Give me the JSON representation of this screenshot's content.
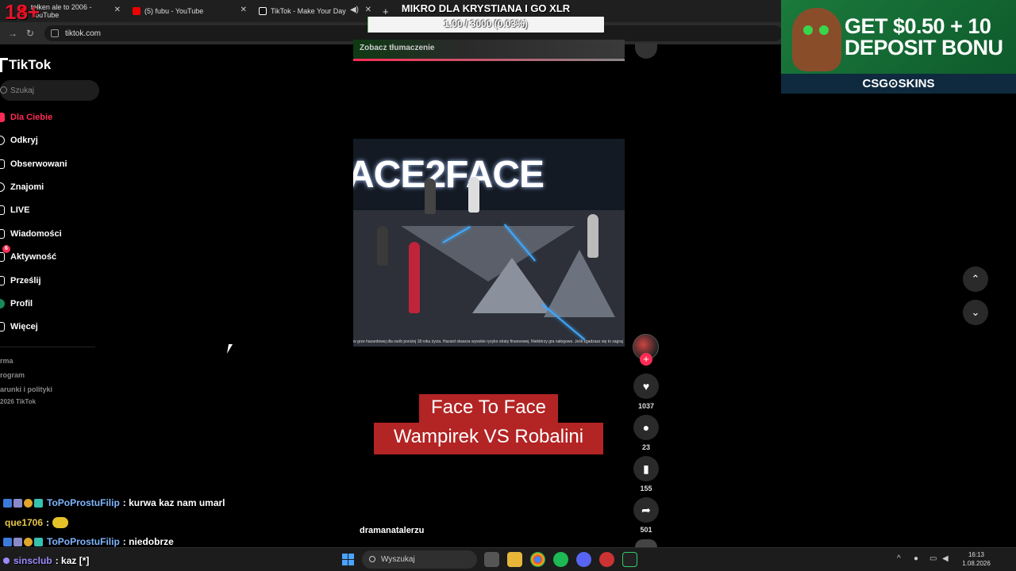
{
  "browser": {
    "tabs": [
      {
        "title": "tełken ale to 2006 - YouTube",
        "close": "✕"
      },
      {
        "title": "(5) fubu - YouTube",
        "close": "✕"
      },
      {
        "title": "TikTok - Make Your Day",
        "close": "✕"
      }
    ],
    "new_tab": "+",
    "url": "tiktok.com",
    "nav": {
      "back": "←",
      "forward": "→",
      "reload": "↻"
    }
  },
  "stream_overlay": {
    "badge": "18+",
    "title": "MIKRO DLA KRYSTIANA I GO XLR",
    "progress_text": "1.00 / 3000 (0.03%)",
    "progress_fraction": 0.0003
  },
  "ad": {
    "line1": "GET $0.50 + 10",
    "line2": "DEPOSIT BONU",
    "brand": "CSG⊙SKINS"
  },
  "tiktok": {
    "logo": "TikTok",
    "search_placeholder": "Szukaj",
    "nav": [
      {
        "label": "Dla Ciebie",
        "icon": "home-icon"
      },
      {
        "label": "Odkryj",
        "icon": "compass-icon"
      },
      {
        "label": "Obserwowani",
        "icon": "following-icon"
      },
      {
        "label": "Znajomi",
        "icon": "friends-icon"
      },
      {
        "label": "LIVE",
        "icon": "live-icon"
      },
      {
        "label": "Wiadomości",
        "icon": "messages-icon"
      },
      {
        "label": "Aktywność",
        "icon": "activity-icon",
        "badge": "6"
      },
      {
        "label": "Prześlij",
        "icon": "upload-icon"
      },
      {
        "label": "Profil",
        "icon": "profile-icon"
      },
      {
        "label": "Więcej",
        "icon": "more-icon"
      }
    ],
    "footer": [
      "rma",
      "rogram",
      "arunki i polityki",
      "2026 TikTok"
    ],
    "prev_video_caption": "Zobacz tłumaczenie",
    "video": {
      "title_text": "ACE2FACE",
      "disclaimer": "w grze hazardowej dla osób poniżej 18 roku życia. Hazard stwarza wysokie ryzyko straty finansowej. Niektórzy gra nałogowo. Jeśli zgadzasz się to zagraj"
    },
    "caption_line1": "Face To Face",
    "caption_line2": "Wampirek VS Robalini",
    "author": "dramanatalerzu",
    "actions": {
      "follow": "+",
      "likes": "1037",
      "comments": "23",
      "saves": "155",
      "shares": "501"
    },
    "pager": {
      "up": "⌃",
      "down": "⌄"
    }
  },
  "chat": [
    {
      "user": "ToPoProstuFilip",
      "message": ": kurwa kaz nam umarl",
      "color": "#7fb5ff"
    },
    {
      "user": "que1706",
      "message": ":",
      "color": "#e8c74a"
    },
    {
      "user": "ToPoProstuFilip",
      "message": ": niedobrze",
      "color": "#7fb5ff"
    },
    {
      "user": "sinsclub",
      "message": ": kaz [*]",
      "color": "#9b8cff"
    }
  ],
  "taskbar": {
    "search_placeholder": "Wyszukaj",
    "time": "16:13",
    "date": "1.08.2026",
    "tray_chevron": "^"
  },
  "colors": {
    "tiktok_accent": "#fe2c55",
    "caption_bg": "#b32424",
    "windows_blue": "#4aa3ff"
  }
}
